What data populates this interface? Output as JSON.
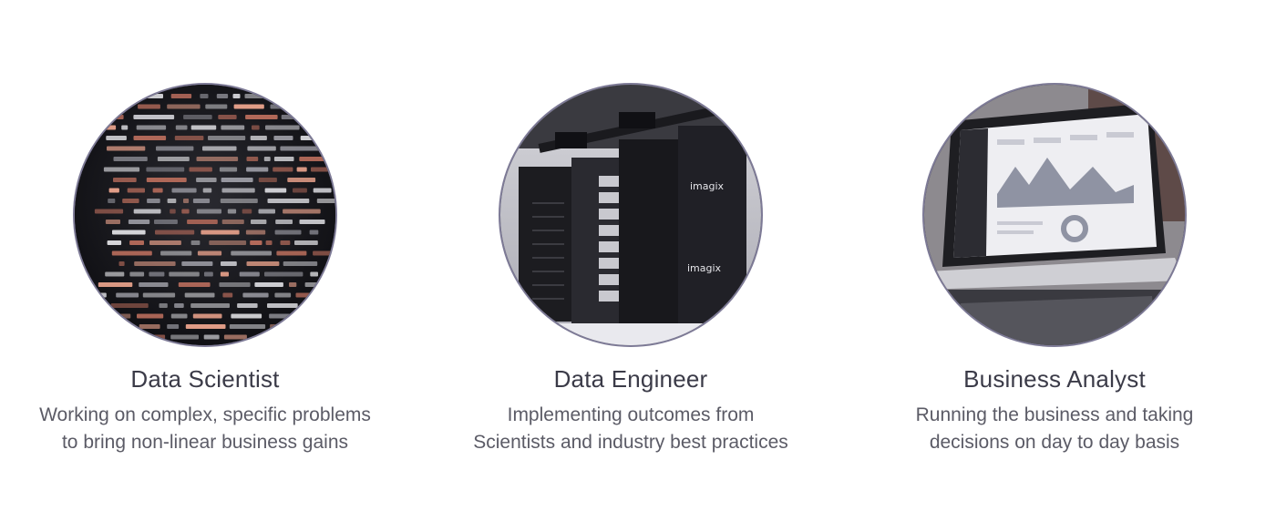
{
  "roles": [
    {
      "title": "Data Scientist",
      "description_lines": [
        "Working on complex, specific problems",
        "to bring non-linear business gains"
      ],
      "image": "code-screen-image"
    },
    {
      "title": "Data Engineer",
      "description_lines": [
        "Implementing outcomes from",
        "Scientists and industry best practices"
      ],
      "image": "server-rack-image",
      "image_text": "imagix"
    },
    {
      "title": "Business Analyst",
      "description_lines": [
        "Running the business and taking",
        "decisions on day to day basis"
      ],
      "image": "laptop-dashboard-image"
    }
  ]
}
